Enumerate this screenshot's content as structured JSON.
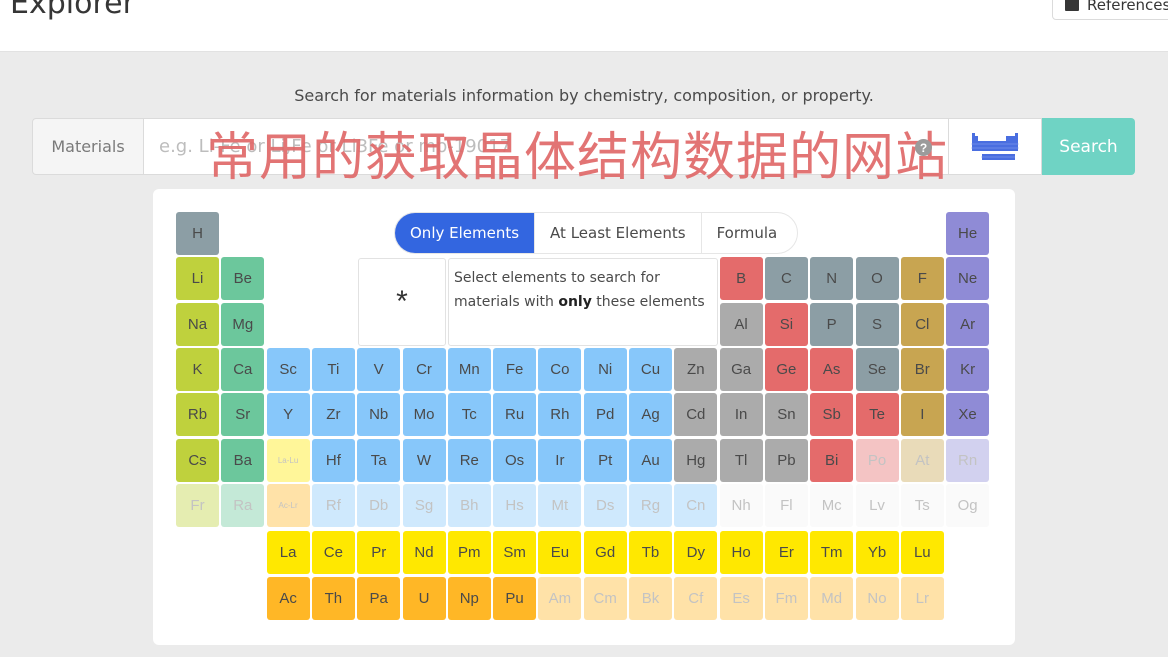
{
  "header": {
    "title": "Explorer",
    "reference_button": "References"
  },
  "search": {
    "subtitle": "Search for materials information by chemistry, composition, or property.",
    "label": "Materials",
    "placeholder": "e.g. Li-Fe or Li,Fe or Li3Fe or mp-19017",
    "value": "",
    "overlay_text": "常用的获取晶体结构数据的网站",
    "help_icon": "?",
    "search_button": "Search"
  },
  "mode_tabs": [
    {
      "label": "Only Elements",
      "active": true
    },
    {
      "label": "At Least Elements",
      "active": false
    },
    {
      "label": "Formula",
      "active": false
    }
  ],
  "wildcard": "*",
  "info": {
    "line1": "Select elements to search for",
    "pre": "materials with ",
    "bold": "only",
    "post": " these elements"
  },
  "colors": {
    "accent": "#3366e0",
    "search_button": "#6fd3c4",
    "overlay_text": "#e06a6a",
    "nonmetal": "#8c9ea5",
    "alkali": "#bfd13d",
    "alkaline_earth": "#6cc79c",
    "transition": "#87c7fa",
    "post_transition": "#ababab",
    "metalloid": "#e46b6b",
    "halogen": "#c8a551",
    "noble_gas": "#8f8bd6",
    "lanthanide": "#ffe800",
    "actinide": "#ffb726"
  },
  "elements": [
    {
      "s": "H",
      "r": 1,
      "c": 1,
      "t": "nonmetal"
    },
    {
      "s": "He",
      "r": 1,
      "c": 18,
      "t": "noble_gas"
    },
    {
      "s": "Li",
      "r": 2,
      "c": 1,
      "t": "alkali"
    },
    {
      "s": "Be",
      "r": 2,
      "c": 2,
      "t": "alkaline_earth"
    },
    {
      "s": "B",
      "r": 2,
      "c": 13,
      "t": "metalloid"
    },
    {
      "s": "C",
      "r": 2,
      "c": 14,
      "t": "nonmetal"
    },
    {
      "s": "N",
      "r": 2,
      "c": 15,
      "t": "nonmetal"
    },
    {
      "s": "O",
      "r": 2,
      "c": 16,
      "t": "nonmetal"
    },
    {
      "s": "F",
      "r": 2,
      "c": 17,
      "t": "halogen"
    },
    {
      "s": "Ne",
      "r": 2,
      "c": 18,
      "t": "noble_gas"
    },
    {
      "s": "Na",
      "r": 3,
      "c": 1,
      "t": "alkali"
    },
    {
      "s": "Mg",
      "r": 3,
      "c": 2,
      "t": "alkaline_earth"
    },
    {
      "s": "Al",
      "r": 3,
      "c": 13,
      "t": "post_transition"
    },
    {
      "s": "Si",
      "r": 3,
      "c": 14,
      "t": "metalloid"
    },
    {
      "s": "P",
      "r": 3,
      "c": 15,
      "t": "nonmetal"
    },
    {
      "s": "S",
      "r": 3,
      "c": 16,
      "t": "nonmetal"
    },
    {
      "s": "Cl",
      "r": 3,
      "c": 17,
      "t": "halogen"
    },
    {
      "s": "Ar",
      "r": 3,
      "c": 18,
      "t": "noble_gas"
    },
    {
      "s": "K",
      "r": 4,
      "c": 1,
      "t": "alkali"
    },
    {
      "s": "Ca",
      "r": 4,
      "c": 2,
      "t": "alkaline_earth"
    },
    {
      "s": "Sc",
      "r": 4,
      "c": 3,
      "t": "transition"
    },
    {
      "s": "Ti",
      "r": 4,
      "c": 4,
      "t": "transition"
    },
    {
      "s": "V",
      "r": 4,
      "c": 5,
      "t": "transition"
    },
    {
      "s": "Cr",
      "r": 4,
      "c": 6,
      "t": "transition"
    },
    {
      "s": "Mn",
      "r": 4,
      "c": 7,
      "t": "transition"
    },
    {
      "s": "Fe",
      "r": 4,
      "c": 8,
      "t": "transition"
    },
    {
      "s": "Co",
      "r": 4,
      "c": 9,
      "t": "transition"
    },
    {
      "s": "Ni",
      "r": 4,
      "c": 10,
      "t": "transition"
    },
    {
      "s": "Cu",
      "r": 4,
      "c": 11,
      "t": "transition"
    },
    {
      "s": "Zn",
      "r": 4,
      "c": 12,
      "t": "post_transition"
    },
    {
      "s": "Ga",
      "r": 4,
      "c": 13,
      "t": "post_transition"
    },
    {
      "s": "Ge",
      "r": 4,
      "c": 14,
      "t": "metalloid"
    },
    {
      "s": "As",
      "r": 4,
      "c": 15,
      "t": "metalloid"
    },
    {
      "s": "Se",
      "r": 4,
      "c": 16,
      "t": "nonmetal"
    },
    {
      "s": "Br",
      "r": 4,
      "c": 17,
      "t": "halogen"
    },
    {
      "s": "Kr",
      "r": 4,
      "c": 18,
      "t": "noble_gas"
    },
    {
      "s": "Rb",
      "r": 5,
      "c": 1,
      "t": "alkali"
    },
    {
      "s": "Sr",
      "r": 5,
      "c": 2,
      "t": "alkaline_earth"
    },
    {
      "s": "Y",
      "r": 5,
      "c": 3,
      "t": "transition"
    },
    {
      "s": "Zr",
      "r": 5,
      "c": 4,
      "t": "transition"
    },
    {
      "s": "Nb",
      "r": 5,
      "c": 5,
      "t": "transition"
    },
    {
      "s": "Mo",
      "r": 5,
      "c": 6,
      "t": "transition"
    },
    {
      "s": "Tc",
      "r": 5,
      "c": 7,
      "t": "transition"
    },
    {
      "s": "Ru",
      "r": 5,
      "c": 8,
      "t": "transition"
    },
    {
      "s": "Rh",
      "r": 5,
      "c": 9,
      "t": "transition"
    },
    {
      "s": "Pd",
      "r": 5,
      "c": 10,
      "t": "transition"
    },
    {
      "s": "Ag",
      "r": 5,
      "c": 11,
      "t": "transition"
    },
    {
      "s": "Cd",
      "r": 5,
      "c": 12,
      "t": "post_transition"
    },
    {
      "s": "In",
      "r": 5,
      "c": 13,
      "t": "post_transition"
    },
    {
      "s": "Sn",
      "r": 5,
      "c": 14,
      "t": "post_transition"
    },
    {
      "s": "Sb",
      "r": 5,
      "c": 15,
      "t": "metalloid"
    },
    {
      "s": "Te",
      "r": 5,
      "c": 16,
      "t": "metalloid"
    },
    {
      "s": "I",
      "r": 5,
      "c": 17,
      "t": "halogen"
    },
    {
      "s": "Xe",
      "r": 5,
      "c": 18,
      "t": "noble_gas"
    },
    {
      "s": "Cs",
      "r": 6,
      "c": 1,
      "t": "alkali"
    },
    {
      "s": "Ba",
      "r": 6,
      "c": 2,
      "t": "alkaline_earth"
    },
    {
      "s": "La-Lu",
      "r": 6,
      "c": 3,
      "t": "lanthanide",
      "faded": true,
      "small": true
    },
    {
      "s": "Hf",
      "r": 6,
      "c": 4,
      "t": "transition"
    },
    {
      "s": "Ta",
      "r": 6,
      "c": 5,
      "t": "transition"
    },
    {
      "s": "W",
      "r": 6,
      "c": 6,
      "t": "transition"
    },
    {
      "s": "Re",
      "r": 6,
      "c": 7,
      "t": "transition"
    },
    {
      "s": "Os",
      "r": 6,
      "c": 8,
      "t": "transition"
    },
    {
      "s": "Ir",
      "r": 6,
      "c": 9,
      "t": "transition"
    },
    {
      "s": "Pt",
      "r": 6,
      "c": 10,
      "t": "transition"
    },
    {
      "s": "Au",
      "r": 6,
      "c": 11,
      "t": "transition"
    },
    {
      "s": "Hg",
      "r": 6,
      "c": 12,
      "t": "post_transition"
    },
    {
      "s": "Tl",
      "r": 6,
      "c": 13,
      "t": "post_transition"
    },
    {
      "s": "Pb",
      "r": 6,
      "c": 14,
      "t": "post_transition"
    },
    {
      "s": "Bi",
      "r": 6,
      "c": 15,
      "t": "metalloid"
    },
    {
      "s": "Po",
      "r": 6,
      "c": 16,
      "t": "metalloid",
      "faded": true
    },
    {
      "s": "At",
      "r": 6,
      "c": 17,
      "t": "halogen",
      "faded": true
    },
    {
      "s": "Rn",
      "r": 6,
      "c": 18,
      "t": "noble_gas",
      "faded": true
    },
    {
      "s": "Fr",
      "r": 7,
      "c": 1,
      "t": "alkali",
      "faded": true
    },
    {
      "s": "Ra",
      "r": 7,
      "c": 2,
      "t": "alkaline_earth",
      "faded": true
    },
    {
      "s": "Ac-Lr",
      "r": 7,
      "c": 3,
      "t": "actinide",
      "faded": true,
      "small": true
    },
    {
      "s": "Rf",
      "r": 7,
      "c": 4,
      "t": "transition",
      "faded": true
    },
    {
      "s": "Db",
      "r": 7,
      "c": 5,
      "t": "transition",
      "faded": true
    },
    {
      "s": "Sg",
      "r": 7,
      "c": 6,
      "t": "transition",
      "faded": true
    },
    {
      "s": "Bh",
      "r": 7,
      "c": 7,
      "t": "transition",
      "faded": true
    },
    {
      "s": "Hs",
      "r": 7,
      "c": 8,
      "t": "transition",
      "faded": true
    },
    {
      "s": "Mt",
      "r": 7,
      "c": 9,
      "t": "transition",
      "faded": true
    },
    {
      "s": "Ds",
      "r": 7,
      "c": 10,
      "t": "transition",
      "faded": true
    },
    {
      "s": "Rg",
      "r": 7,
      "c": 11,
      "t": "transition",
      "faded": true
    },
    {
      "s": "Cn",
      "r": 7,
      "c": 12,
      "t": "transition",
      "faded": true
    },
    {
      "s": "Nh",
      "r": 7,
      "c": 13,
      "t": "unknown",
      "faded": true
    },
    {
      "s": "Fl",
      "r": 7,
      "c": 14,
      "t": "unknown",
      "faded": true
    },
    {
      "s": "Mc",
      "r": 7,
      "c": 15,
      "t": "unknown",
      "faded": true
    },
    {
      "s": "Lv",
      "r": 7,
      "c": 16,
      "t": "unknown",
      "faded": true
    },
    {
      "s": "Ts",
      "r": 7,
      "c": 17,
      "t": "unknown",
      "faded": true
    },
    {
      "s": "Og",
      "r": 7,
      "c": 18,
      "t": "unknown",
      "faded": true
    },
    {
      "s": "La",
      "r": 8,
      "c": 3,
      "t": "lanthanide"
    },
    {
      "s": "Ce",
      "r": 8,
      "c": 4,
      "t": "lanthanide"
    },
    {
      "s": "Pr",
      "r": 8,
      "c": 5,
      "t": "lanthanide"
    },
    {
      "s": "Nd",
      "r": 8,
      "c": 6,
      "t": "lanthanide"
    },
    {
      "s": "Pm",
      "r": 8,
      "c": 7,
      "t": "lanthanide"
    },
    {
      "s": "Sm",
      "r": 8,
      "c": 8,
      "t": "lanthanide"
    },
    {
      "s": "Eu",
      "r": 8,
      "c": 9,
      "t": "lanthanide"
    },
    {
      "s": "Gd",
      "r": 8,
      "c": 10,
      "t": "lanthanide"
    },
    {
      "s": "Tb",
      "r": 8,
      "c": 11,
      "t": "lanthanide"
    },
    {
      "s": "Dy",
      "r": 8,
      "c": 12,
      "t": "lanthanide"
    },
    {
      "s": "Ho",
      "r": 8,
      "c": 13,
      "t": "lanthanide"
    },
    {
      "s": "Er",
      "r": 8,
      "c": 14,
      "t": "lanthanide"
    },
    {
      "s": "Tm",
      "r": 8,
      "c": 15,
      "t": "lanthanide"
    },
    {
      "s": "Yb",
      "r": 8,
      "c": 16,
      "t": "lanthanide"
    },
    {
      "s": "Lu",
      "r": 8,
      "c": 17,
      "t": "lanthanide"
    },
    {
      "s": "Ac",
      "r": 9,
      "c": 3,
      "t": "actinide"
    },
    {
      "s": "Th",
      "r": 9,
      "c": 4,
      "t": "actinide"
    },
    {
      "s": "Pa",
      "r": 9,
      "c": 5,
      "t": "actinide"
    },
    {
      "s": "U",
      "r": 9,
      "c": 6,
      "t": "actinide"
    },
    {
      "s": "Np",
      "r": 9,
      "c": 7,
      "t": "actinide"
    },
    {
      "s": "Pu",
      "r": 9,
      "c": 8,
      "t": "actinide"
    },
    {
      "s": "Am",
      "r": 9,
      "c": 9,
      "t": "actinide",
      "faded": true
    },
    {
      "s": "Cm",
      "r": 9,
      "c": 10,
      "t": "actinide",
      "faded": true
    },
    {
      "s": "Bk",
      "r": 9,
      "c": 11,
      "t": "actinide",
      "faded": true
    },
    {
      "s": "Cf",
      "r": 9,
      "c": 12,
      "t": "actinide",
      "faded": true
    },
    {
      "s": "Es",
      "r": 9,
      "c": 13,
      "t": "actinide",
      "faded": true
    },
    {
      "s": "Fm",
      "r": 9,
      "c": 14,
      "t": "actinide",
      "faded": true
    },
    {
      "s": "Md",
      "r": 9,
      "c": 15,
      "t": "actinide",
      "faded": true
    },
    {
      "s": "No",
      "r": 9,
      "c": 16,
      "t": "actinide",
      "faded": true
    },
    {
      "s": "Lr",
      "r": 9,
      "c": 17,
      "t": "actinide",
      "faded": true
    }
  ]
}
